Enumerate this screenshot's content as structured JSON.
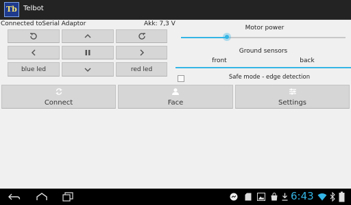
{
  "app": {
    "title": "Telbot",
    "icon_text": "Tb"
  },
  "status": {
    "connection": "Connected toSerial Adaptor",
    "battery": "Akk: 7,3 V"
  },
  "controls": {
    "rotate_left_icon": "rotate-ccw-icon",
    "up_icon": "chevron-up-icon",
    "rotate_right_icon": "rotate-cw-icon",
    "left_icon": "chevron-left-icon",
    "pause_icon": "pause-icon",
    "right_icon": "chevron-right-icon",
    "blue_led": "blue led",
    "down_icon": "chevron-down-icon",
    "red_led": "red led"
  },
  "motor": {
    "label": "Motor power",
    "value_fraction": 0.28
  },
  "ground": {
    "label": "Ground sensors",
    "front": "front",
    "back": "back"
  },
  "safe_mode": {
    "label": "Safe mode - edge detection",
    "checked": false
  },
  "actions": {
    "connect": "Connect",
    "face": "Face",
    "settings": "Settings"
  },
  "systembar": {
    "time": "6:43"
  },
  "colors": {
    "accent": "#33b5e5",
    "button": "#d6d6d6",
    "actionbar": "#232323",
    "background": "#f0f0f0"
  }
}
